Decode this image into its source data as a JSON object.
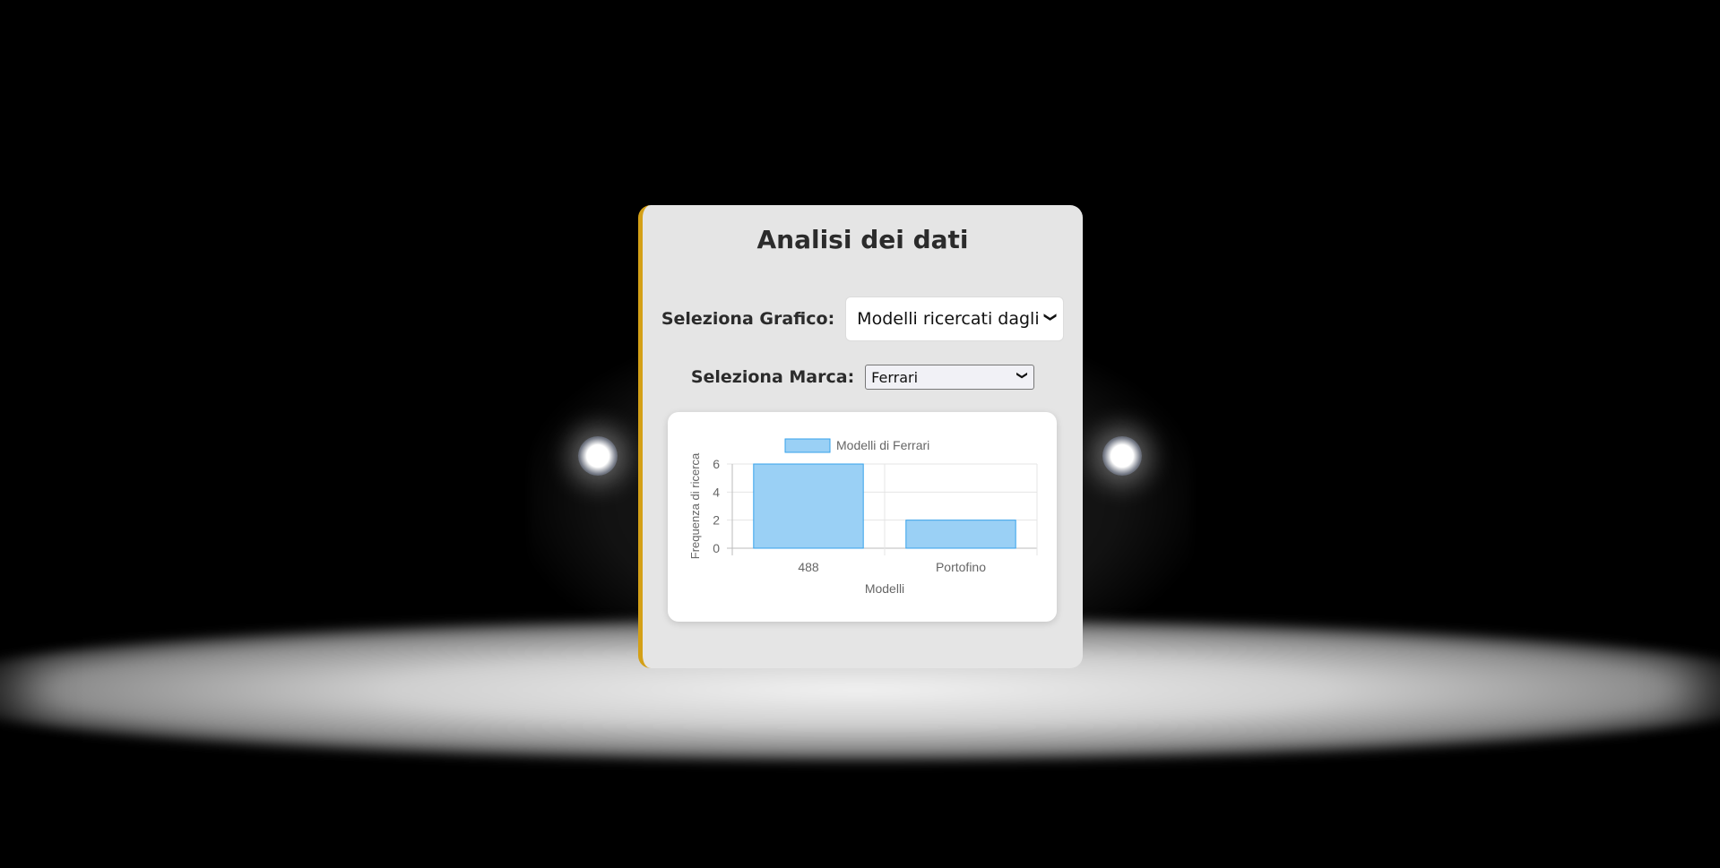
{
  "page": {
    "title": "Analisi dei dati"
  },
  "controls": {
    "chart_select_label": "Seleziona Grafico:",
    "chart_select_value": "Modelli ricercati dagli utenti",
    "brand_select_label": "Seleziona Marca:",
    "brand_select_value": "Ferrari"
  },
  "colors": {
    "accent": "#d4a017",
    "bar_fill": "#9ad0f5",
    "bar_border": "#36a2eb"
  },
  "chart_data": {
    "type": "bar",
    "categories": [
      "488",
      "Portofino"
    ],
    "series": [
      {
        "name": "Modelli di Ferrari",
        "values": [
          6,
          2
        ]
      }
    ],
    "xlabel": "Modelli",
    "ylabel": "Frequenza di ricerca",
    "ylim": [
      0,
      6
    ],
    "yticks": [
      0,
      2,
      4,
      6
    ],
    "grid": true,
    "legend": "top"
  }
}
